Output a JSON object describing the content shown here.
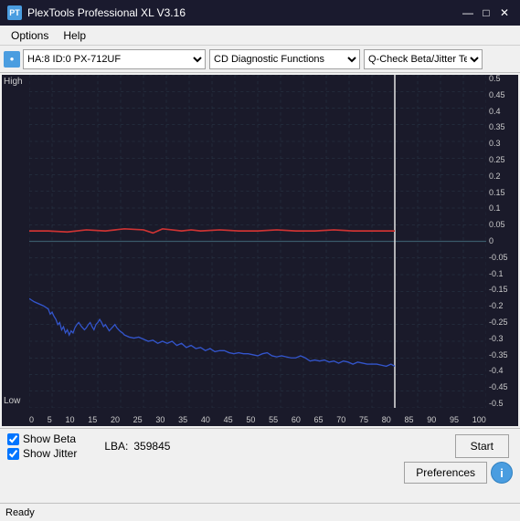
{
  "titleBar": {
    "icon": "PT",
    "title": "PlexTools Professional XL V3.16",
    "minimize": "—",
    "maximize": "□",
    "close": "✕"
  },
  "menuBar": {
    "items": [
      "Options",
      "Help"
    ]
  },
  "toolbar": {
    "deviceIcon": "●",
    "driveLabel": "HA:8 ID:0  PX-712UF",
    "functionLabel": "CD Diagnostic Functions",
    "testLabel": "Q-Check Beta/Jitter Test"
  },
  "chart": {
    "yAxisLeft": {
      "high": "High",
      "low": "Low"
    },
    "yAxisRight": {
      "values": [
        "0.5",
        "0.45",
        "0.4",
        "0.35",
        "0.3",
        "0.25",
        "0.2",
        "0.15",
        "0.1",
        "0.05",
        "0",
        "-0.05",
        "-0.1",
        "-0.15",
        "-0.2",
        "-0.25",
        "-0.3",
        "-0.35",
        "-0.4",
        "-0.45",
        "-0.5"
      ]
    },
    "xAxis": {
      "values": [
        "0",
        "5",
        "10",
        "15",
        "20",
        "25",
        "30",
        "35",
        "40",
        "45",
        "50",
        "55",
        "60",
        "65",
        "70",
        "75",
        "80",
        "85",
        "90",
        "95",
        "100"
      ]
    }
  },
  "bottomPanel": {
    "showBeta": {
      "label": "Show Beta",
      "checked": true
    },
    "showJitter": {
      "label": "Show Jitter",
      "checked": true
    },
    "lba": {
      "label": "LBA:",
      "value": "359845"
    },
    "startButton": "Start",
    "preferencesButton": "Preferences",
    "infoButton": "i"
  },
  "statusBar": {
    "text": "Ready"
  }
}
